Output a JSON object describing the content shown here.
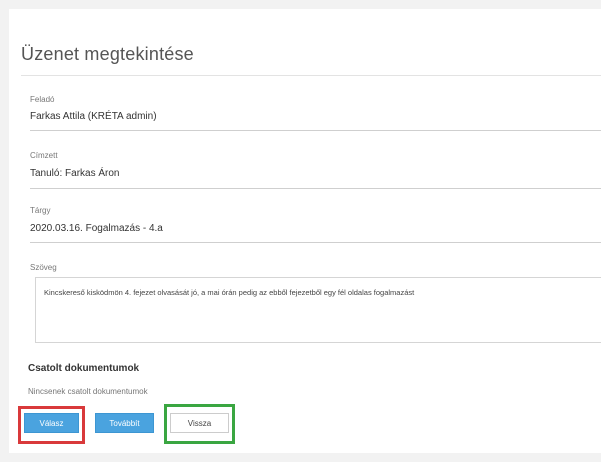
{
  "page": {
    "title": "Üzenet megtekintése"
  },
  "fields": {
    "sender": {
      "label": "Feladó",
      "value": "Farkas Attila (KRÉTA admin)"
    },
    "recipient": {
      "label": "Címzett",
      "value": "Tanuló: Farkas Áron"
    },
    "subject": {
      "label": "Tárgy",
      "value": "2020.03.16. Fogalmazás - 4.a"
    },
    "body": {
      "label": "Szöveg",
      "value": "Kincskereső kisködmön 4. fejezet olvasását jó, a mai órán pedig az ebből fejezetből egy fél oldalas fogalmazást"
    }
  },
  "attachments": {
    "title": "Csatolt dokumentumok",
    "empty_text": "Nincsenek csatolt dokumentumok"
  },
  "buttons": {
    "reply": "Válasz",
    "forward": "Továbbít",
    "back": "Vissza"
  },
  "highlights": {
    "reply_outline_color": "#d9393b",
    "back_outline_color": "#3aa641"
  },
  "colors": {
    "primary_button": "#4aa3df"
  }
}
